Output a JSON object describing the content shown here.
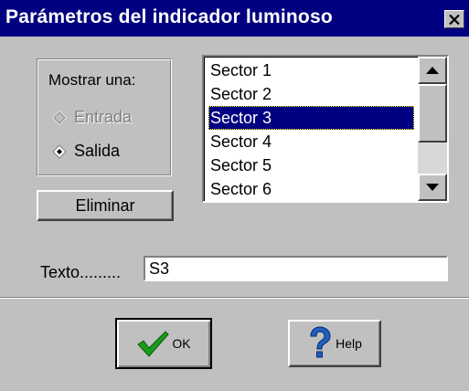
{
  "window": {
    "title": "Parámetros del indicador luminoso",
    "close_icon": "close-icon",
    "close_glyph": "✕"
  },
  "colors": {
    "titlebar": "#000080",
    "face": "#c0c0c0",
    "selection": "#000080",
    "check_green": "#1a9a1a",
    "help_blue": "#1f5fbf"
  },
  "mostrar": {
    "label": "Mostrar una:",
    "options": [
      {
        "label": "Entrada",
        "selected": false,
        "enabled": false
      },
      {
        "label": "Salida",
        "selected": true,
        "enabled": true
      }
    ]
  },
  "eliminar": {
    "label": "Eliminar"
  },
  "sectors": {
    "items": [
      "Sector 1",
      "Sector 2",
      "Sector 3",
      "Sector 4",
      "Sector 5",
      "Sector 6"
    ],
    "selected": "Sector 3"
  },
  "texto": {
    "label": "Texto.........",
    "value": "S3"
  },
  "buttons": {
    "ok": {
      "label": "OK",
      "icon": "checkmark-icon"
    },
    "help": {
      "label": "Help",
      "icon": "question-mark-icon"
    }
  }
}
